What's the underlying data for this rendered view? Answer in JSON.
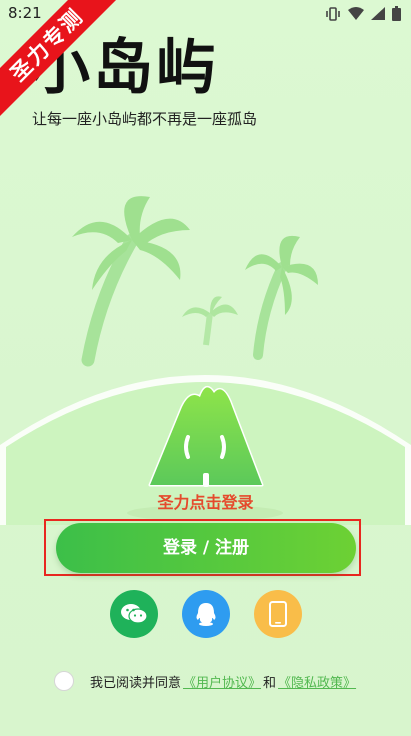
{
  "status_bar": {
    "time": "8:21"
  },
  "ribbon": {
    "text": "圣力专测"
  },
  "app": {
    "title": "小岛屿",
    "slogan": "让每一座小岛屿都不再是一座孤岛"
  },
  "mascot": {
    "caption": "圣力点击登录"
  },
  "login": {
    "button_label": "登录 / 注册"
  },
  "social_login": [
    {
      "name": "wechat",
      "icon": "wechat-icon",
      "color": "#1fb25a"
    },
    {
      "name": "qq",
      "icon": "qq-icon",
      "color": "#2e9cf0"
    },
    {
      "name": "phone",
      "icon": "phone-icon",
      "color": "#f9bd49"
    }
  ],
  "agreement": {
    "prefix": "我已阅读并同意",
    "user_agreement": "《用户协议》",
    "conjunction": "和",
    "privacy_policy": "《隐私政策》",
    "checked": false
  },
  "colors": {
    "background": "#dcf9d2",
    "primary_green": "#3cbf49",
    "ribbon_red": "#e8141b",
    "highlight_red": "#e8271f",
    "link_green": "#52b850"
  }
}
